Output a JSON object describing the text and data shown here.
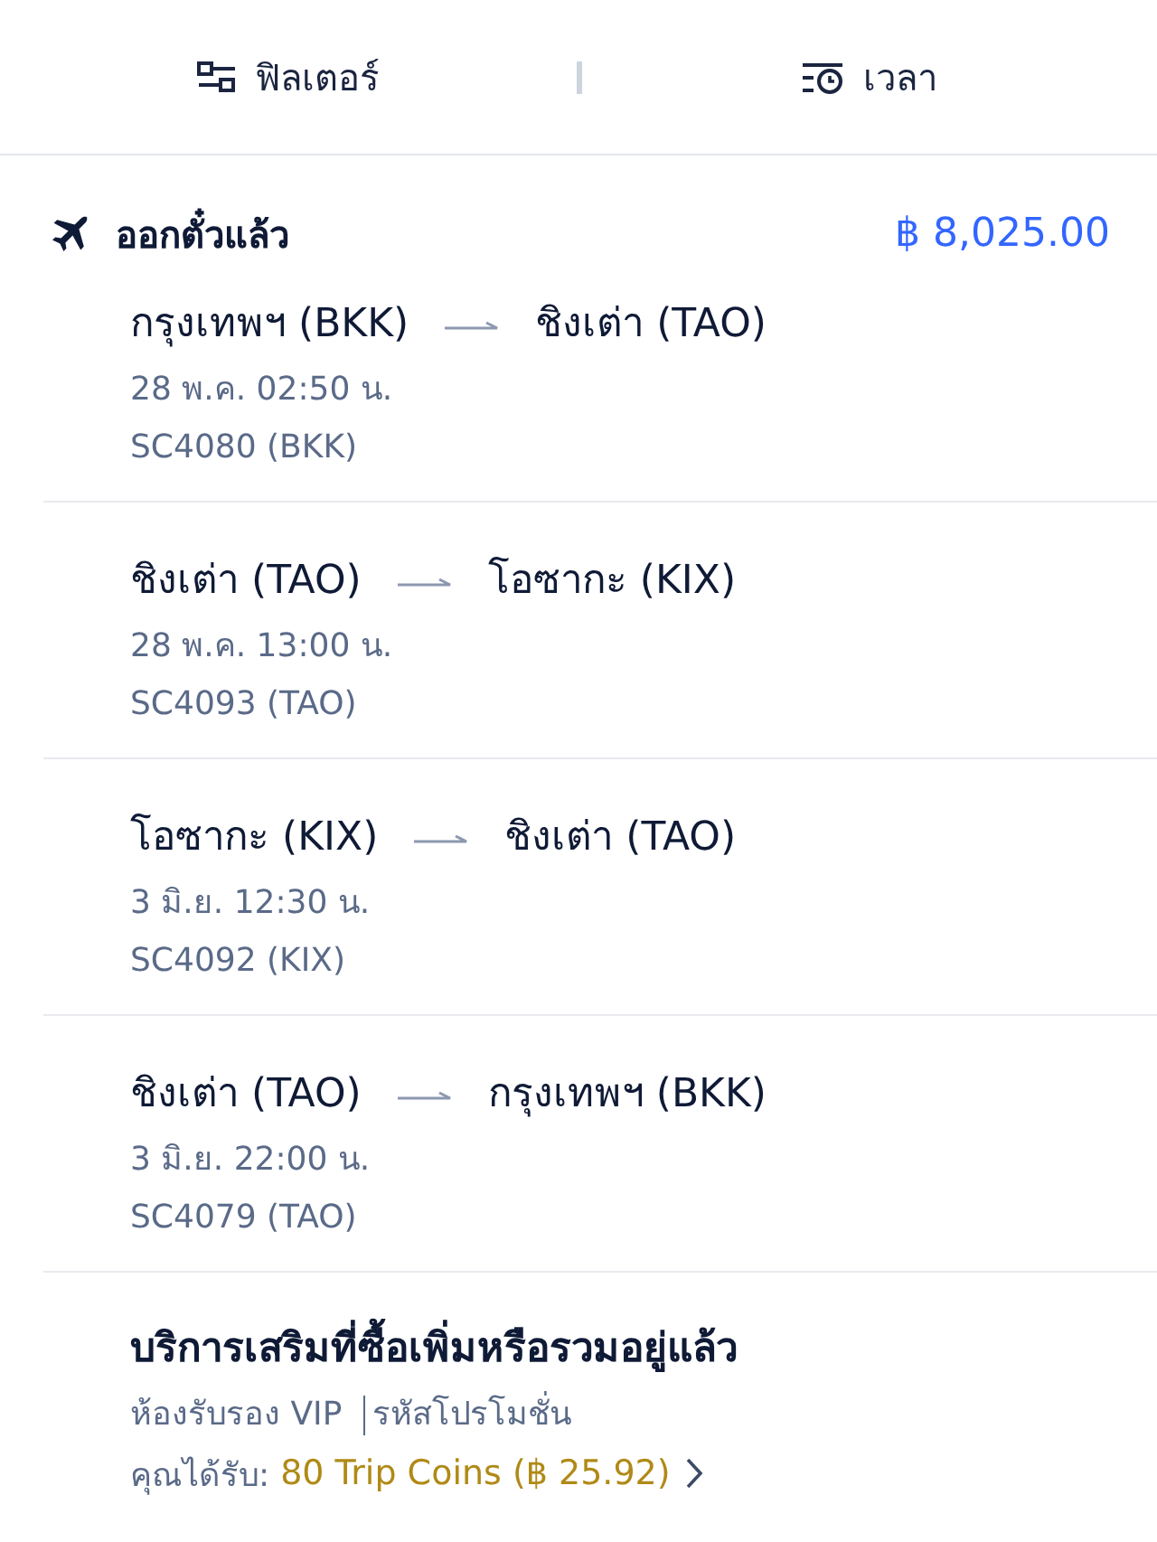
{
  "toolbar": {
    "buttons": [
      {
        "kind": "filter",
        "label": "ฟิลเตอร์"
      },
      {
        "kind": "time",
        "label": "เวลา"
      }
    ]
  },
  "trip": {
    "status": "ออกตั๋วแล้ว",
    "price": "฿ 8,025.00",
    "segments": [
      {
        "from": "กรุงเทพฯ (BKK)",
        "to": "ชิงเต่า (TAO)",
        "date": "28 พ.ค. 02:50 น.",
        "flight": "SC4080 (BKK)"
      },
      {
        "from": "ชิงเต่า (TAO)",
        "to": "โอซากะ (KIX)",
        "date": "28 พ.ค. 13:00 น.",
        "flight": "SC4093 (TAO)"
      },
      {
        "from": "โอซากะ (KIX)",
        "to": "ชิงเต่า (TAO)",
        "date": "3 มิ.ย. 12:30 น.",
        "flight": "SC4092 (KIX)"
      },
      {
        "from": "ชิงเต่า (TAO)",
        "to": "กรุงเทพฯ (BKK)",
        "date": "3 มิ.ย. 22:00 น.",
        "flight": "SC4079 (TAO)"
      }
    ]
  },
  "extras": {
    "title": "บริการเสริมที่ซื้อเพิ่มหรือรวมอยู่แล้ว",
    "items": [
      "ห้องรับรอง VIP",
      "รหัสโปรโมชั่น"
    ],
    "reward_label": "คุณได้รับ:",
    "reward_value": "80 Trip Coins (฿ 25.92)"
  }
}
